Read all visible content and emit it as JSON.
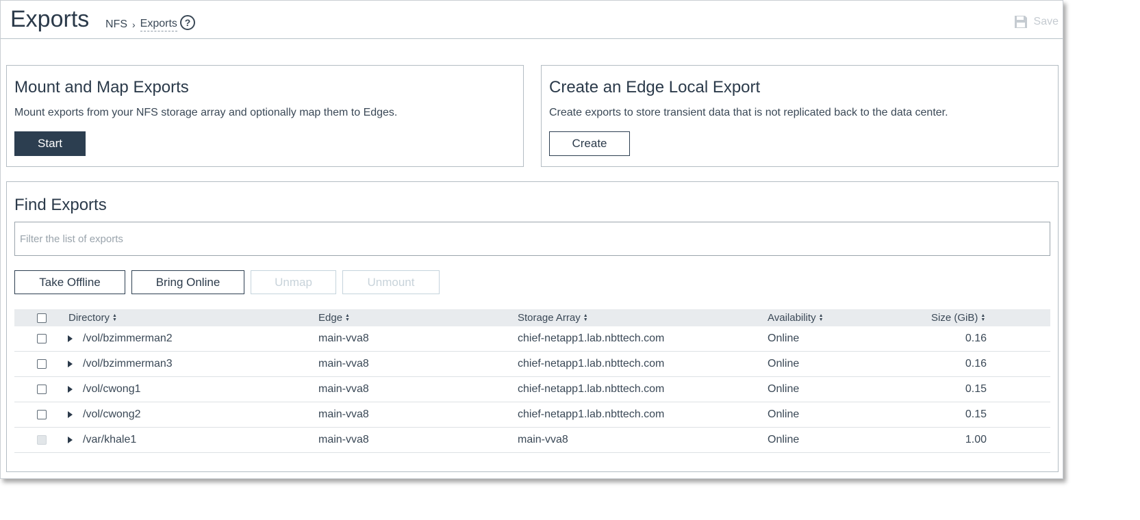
{
  "header": {
    "title": "Exports",
    "breadcrumb": {
      "parent": "NFS",
      "separator": "›",
      "current": "Exports"
    },
    "help_icon": "help-circle-icon",
    "save_label": "Save",
    "save_icon": "floppy-disk-icon"
  },
  "mount_card": {
    "title": "Mount and Map Exports",
    "description": "Mount exports from your NFS storage array and optionally map them to Edges.",
    "button_label": "Start"
  },
  "edge_card": {
    "title": "Create an Edge Local Export",
    "description": "Create exports to store transient data that is not replicated back to the data center.",
    "button_label": "Create"
  },
  "find": {
    "title": "Find Exports",
    "filter_placeholder": "Filter the list of exports",
    "actions": {
      "take_offline": "Take Offline",
      "bring_online": "Bring Online",
      "unmap": "Unmap",
      "unmount": "Unmount"
    }
  },
  "table": {
    "columns": {
      "directory": "Directory",
      "edge": "Edge",
      "storage_array": "Storage Array",
      "availability": "Availability",
      "size": "Size (GiB)"
    },
    "rows": [
      {
        "directory": "/vol/bzimmerman2",
        "edge": "main-vva8",
        "storage_array": "chief-netapp1.lab.nbttech.com",
        "availability": "Online",
        "size": "0.16",
        "selectable": true
      },
      {
        "directory": "/vol/bzimmerman3",
        "edge": "main-vva8",
        "storage_array": "chief-netapp1.lab.nbttech.com",
        "availability": "Online",
        "size": "0.16",
        "selectable": true
      },
      {
        "directory": "/vol/cwong1",
        "edge": "main-vva8",
        "storage_array": "chief-netapp1.lab.nbttech.com",
        "availability": "Online",
        "size": "0.15",
        "selectable": true
      },
      {
        "directory": "/vol/cwong2",
        "edge": "main-vva8",
        "storage_array": "chief-netapp1.lab.nbttech.com",
        "availability": "Online",
        "size": "0.15",
        "selectable": true
      },
      {
        "directory": "/var/khale1",
        "edge": "main-vva8",
        "storage_array": "main-vva8",
        "availability": "Online",
        "size": "1.00",
        "selectable": false
      }
    ]
  },
  "colors": {
    "primary_dark": "#2c3e50",
    "text": "#2b3a4a",
    "disabled_text": "#c8d3da",
    "header_row_bg": "#e8ebee"
  }
}
